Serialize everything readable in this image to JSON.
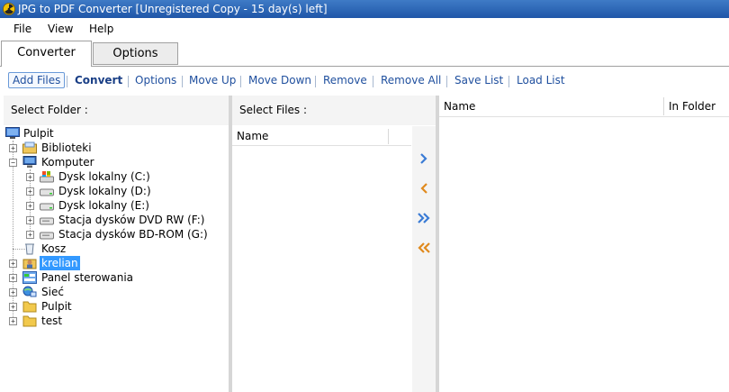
{
  "window": {
    "title": "JPG to PDF Converter [Unregistered Copy - 15 day(s) left]"
  },
  "menu": {
    "file": "File",
    "view": "View",
    "help": "Help"
  },
  "tabs": {
    "converter": "Converter",
    "options": "Options"
  },
  "toolbar": {
    "add_files": "Add Files",
    "convert": "Convert",
    "options": "Options",
    "move_up": "Move Up",
    "move_down": "Move Down",
    "remove": "Remove",
    "remove_all": "Remove All",
    "save_list": "Save List",
    "load_list": "Load List"
  },
  "select_folder": {
    "header": "Select Folder :",
    "tree": {
      "root": "Pulpit",
      "biblioteki": "Biblioteki",
      "komputer": "Komputer",
      "drive_c": "Dysk lokalny (C:)",
      "drive_d": "Dysk lokalny (D:)",
      "drive_e": "Dysk lokalny (E:)",
      "drive_f": "Stacja dysków DVD RW (F:)",
      "drive_g": "Stacja dysków BD-ROM (G:)",
      "kosz": "Kosz",
      "krelian": "krelian",
      "panel": "Panel sterowania",
      "siec": "Sieć",
      "pulpit": "Pulpit",
      "test": "test"
    }
  },
  "select_files": {
    "header": "Select Files :",
    "col_name": "Name"
  },
  "file_list": {
    "col_name": "Name",
    "col_folder": "In Folder"
  },
  "colors": {
    "accent": "#3399ff",
    "link": "#1f4f9e",
    "arrow_blue": "#3a7bd5",
    "arrow_orange": "#e08a1e"
  }
}
